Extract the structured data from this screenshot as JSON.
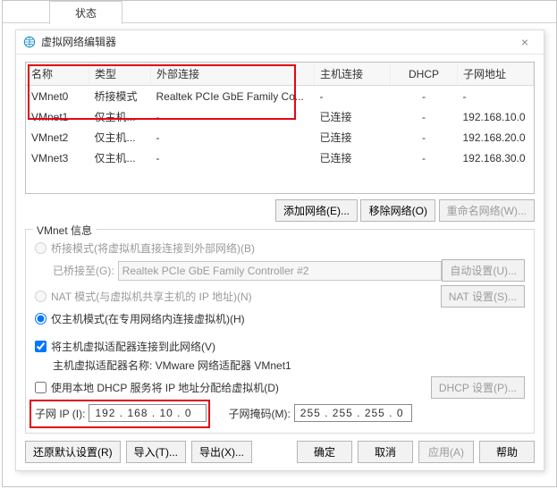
{
  "main_tab": "状态",
  "dialog": {
    "title": "虚拟网络编辑器",
    "close_glyph": "×"
  },
  "table": {
    "headers": {
      "name": "名称",
      "type": "类型",
      "ext": "外部连接",
      "host": "主机连接",
      "dhcp": "DHCP",
      "subnet": "子网地址"
    },
    "r0": {
      "name": "VMnet0",
      "type": "桥接模式",
      "ext": "Realtek PCIe GbE Family Co...",
      "host": "-",
      "dhcp": "-",
      "subnet": "-"
    },
    "r1": {
      "name": "VMnet1",
      "type": "仅主机...",
      "ext": "-",
      "host": "已连接",
      "dhcp": "-",
      "subnet": "192.168.10.0"
    },
    "r2": {
      "name": "VMnet2",
      "type": "仅主机...",
      "ext": "-",
      "host": "已连接",
      "dhcp": "-",
      "subnet": "192.168.20.0"
    },
    "r3": {
      "name": "VMnet3",
      "type": "仅主机...",
      "ext": "-",
      "host": "已连接",
      "dhcp": "-",
      "subnet": "192.168.30.0"
    }
  },
  "buttons": {
    "add_net": "添加网络(E)...",
    "remove_net": "移除网络(O)",
    "rename_net": "重命名网络(W)..."
  },
  "info": {
    "group_title": "VMnet 信息",
    "radio_bridge": "桥接模式(将虚拟机直接连接到外部网络)(B)",
    "bridge_to_label": "已桥接至(G):",
    "bridge_to_value": "Realtek PCIe GbE Family Controller #2",
    "auto_set": "自动设置(U)...",
    "radio_nat": "NAT 模式(与虚拟机共享主机的 IP 地址)(N)",
    "nat_set": "NAT 设置(S)...",
    "radio_hostonly": "仅主机模式(在专用网络内连接虚拟机)(H)",
    "chk_hostadapter": "将主机虚拟适配器连接到此网络(V)",
    "hostadapter_name_label": "主机虚拟适配器名称: VMware 网络适配器 VMnet1",
    "chk_dhcp": "使用本地 DHCP 服务将 IP 地址分配给虚拟机(D)",
    "dhcp_set": "DHCP 设置(P)...",
    "subnet_ip_label": "子网 IP (I):",
    "subnet_ip_value": "192 . 168 . 10 . 0",
    "subnet_mask_label": "子网掩码(M):",
    "subnet_mask_value": "255 . 255 . 255 . 0"
  },
  "bottom": {
    "restore": "还原默认设置(R)",
    "import": "导入(T)...",
    "export": "导出(X)...",
    "ok": "确定",
    "cancel": "取消",
    "apply": "应用(A)",
    "help": "帮助"
  }
}
